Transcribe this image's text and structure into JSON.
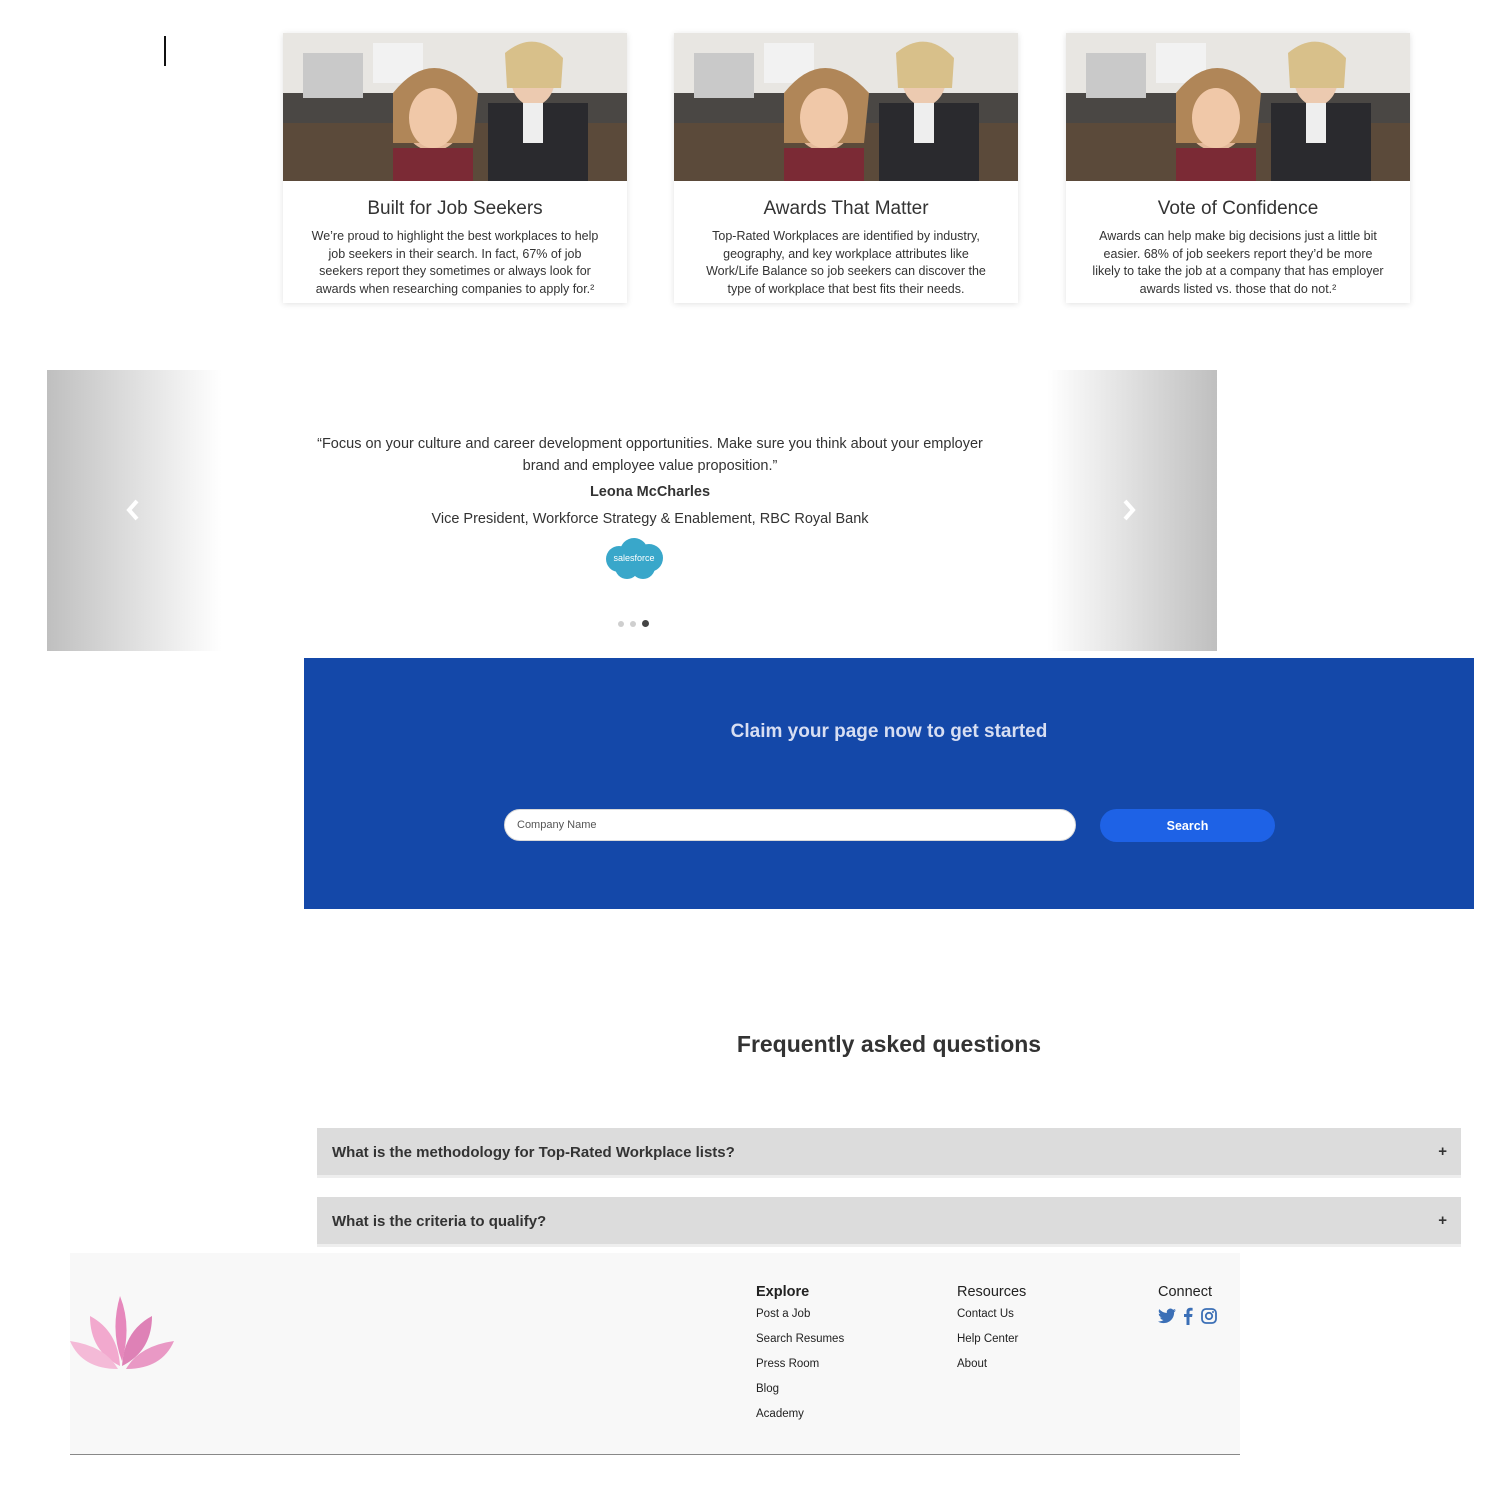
{
  "cards": [
    {
      "title": "Built for Job Seekers",
      "text": "We’re proud to highlight the best workplaces to help job seekers in their search. In fact, 67% of job seekers report they sometimes or always look for awards when researching companies to apply for.²"
    },
    {
      "title": "Awards That Matter",
      "text": "Top-Rated Workplaces are identified by industry, geography, and key workplace attributes like Work/Life Balance so job seekers can discover the type of workplace that best fits their needs."
    },
    {
      "title": "Vote of Confidence",
      "text": "Awards can help make big decisions just a little bit easier. 68% of job seekers report they’d be more likely to take the job at a company that has employer awards listed vs. those that do not.²"
    }
  ],
  "testimonial": {
    "quote": "“Focus on your culture and career development opportunities. Make sure you think about your employer brand and employee value proposition.”",
    "name": "Leona McCharles",
    "role": "Vice President, Workforce Strategy & Enablement, RBC Royal Bank",
    "logo_text": "salesforce",
    "slide_count": 3,
    "active_slide": 3
  },
  "claim": {
    "heading": "Claim your page now to get started",
    "input_placeholder": "Company Name",
    "button_label": "Search"
  },
  "faq": {
    "title": "Frequently asked questions",
    "items": [
      {
        "question": "What is the methodology for Top-Rated Workplace lists?",
        "toggle": "+"
      },
      {
        "question": "What is the criteria to qualify?",
        "toggle": "+"
      }
    ]
  },
  "footer": {
    "explore": {
      "title": "Explore",
      "links": [
        "Post a Job",
        "Search Resumes",
        "Press Room",
        "Blog",
        "Academy"
      ]
    },
    "resources": {
      "title": "Resources",
      "links": [
        "Contact Us",
        "Help Center",
        "About"
      ]
    },
    "connect": {
      "title": "Connect",
      "icons": [
        "twitter-icon",
        "facebook-icon",
        "instagram-icon"
      ]
    }
  },
  "colors": {
    "banner_blue": "#1448a9",
    "button_blue": "#1e62e6",
    "social_blue": "#3b6fb6",
    "faq_gray": "#dcdcdc"
  }
}
